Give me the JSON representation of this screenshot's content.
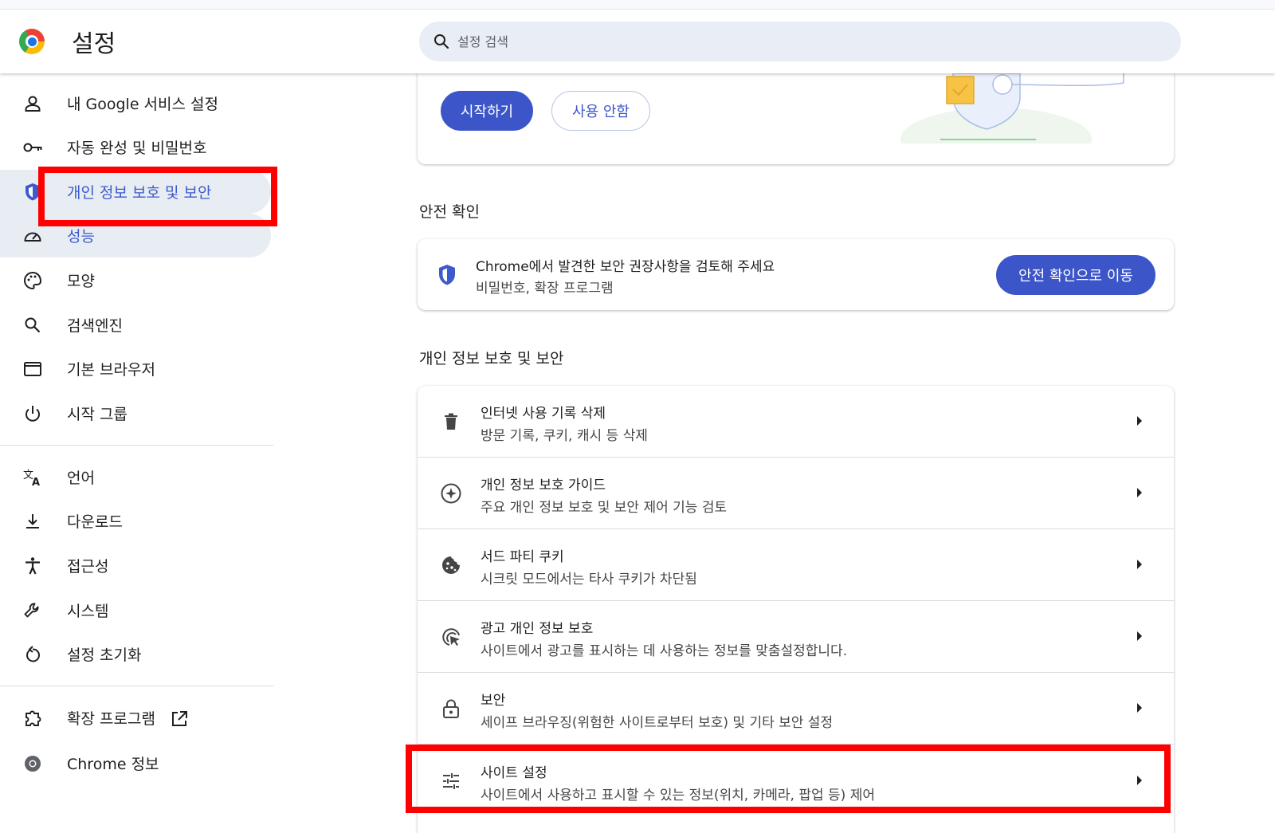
{
  "header": {
    "title": "설정",
    "search_placeholder": "설정 검색"
  },
  "sidebar": {
    "items": [
      {
        "label": "내 Google 서비스 설정",
        "icon": "person-icon"
      },
      {
        "label": "자동 완성 및 비밀번호",
        "icon": "key-icon"
      },
      {
        "label": "개인 정보 보호 및 보안",
        "icon": "shield-icon",
        "active": true
      },
      {
        "label": "성능",
        "icon": "speedometer-icon"
      },
      {
        "label": "모양",
        "icon": "palette-icon"
      },
      {
        "label": "검색엔진",
        "icon": "search-icon"
      },
      {
        "label": "기본 브라우저",
        "icon": "browser-window-icon"
      },
      {
        "label": "시작 그룹",
        "icon": "power-icon"
      },
      {
        "label": "언어",
        "icon": "translate-icon"
      },
      {
        "label": "다운로드",
        "icon": "download-icon"
      },
      {
        "label": "접근성",
        "icon": "accessibility-icon"
      },
      {
        "label": "시스템",
        "icon": "wrench-icon"
      },
      {
        "label": "설정 초기화",
        "icon": "reset-icon"
      },
      {
        "label": "확장 프로그램",
        "icon": "extension-icon"
      },
      {
        "label": "Chrome 정보",
        "icon": "chrome-icon"
      }
    ]
  },
  "top_card": {
    "start_label": "시작하기",
    "decline_label": "사용 안함"
  },
  "safety_check": {
    "section_title": "안전 확인",
    "title": "Chrome에서 발견한 보안 권장사항을 검토해 주세요",
    "subtitle": "비밀번호, 확장 프로그램",
    "button_label": "안전 확인으로 이동"
  },
  "privacy": {
    "section_title": "개인 정보 보호 및 보안",
    "rows": [
      {
        "title": "인터넷 사용 기록 삭제",
        "subtitle": "방문 기록, 쿠키, 캐시 등 삭제",
        "icon": "trash-icon"
      },
      {
        "title": "개인 정보 보호 가이드",
        "subtitle": "주요 개인 정보 보호 및 보안 제어 기능 검토",
        "icon": "compass-icon"
      },
      {
        "title": "서드 파티 쿠키",
        "subtitle": "시크릿 모드에서는 타사 쿠키가 차단됨",
        "icon": "cookie-icon"
      },
      {
        "title": "광고 개인 정보 보호",
        "subtitle": "사이트에서 광고를 표시하는 데 사용하는 정보를 맞춤설정합니다.",
        "icon": "ad-privacy-icon"
      },
      {
        "title": "보안",
        "subtitle": "세이프 브라우징(위험한 사이트로부터 보호) 및 기타 보안 설정",
        "icon": "lock-icon"
      },
      {
        "title": "사이트 설정",
        "subtitle": "사이트에서 사용하고 표시할 수 있는 정보(위치, 카메라, 팝업 등) 제어",
        "icon": "sliders-icon"
      }
    ]
  },
  "colors": {
    "accent": "#3c56c9",
    "highlight": "#ff0000",
    "active_bg": "#e8ecf3"
  }
}
